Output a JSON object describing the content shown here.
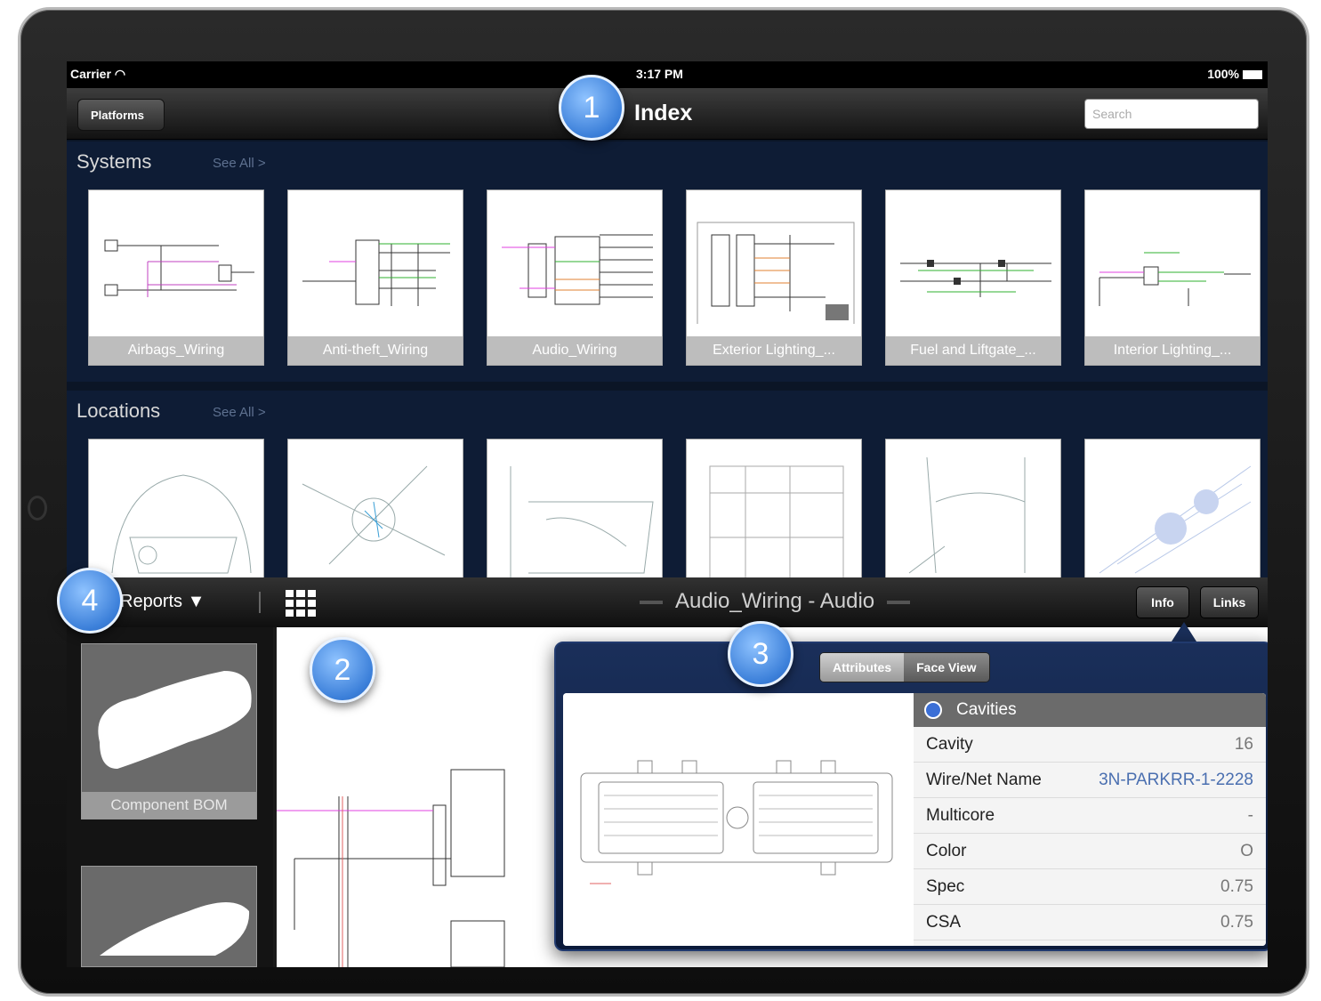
{
  "status_bar": {
    "carrier": "Carrier",
    "time": "3:17 PM",
    "battery": "100%"
  },
  "nav": {
    "back_label": "Platforms",
    "title": "Index",
    "search_placeholder": "Search"
  },
  "systems": {
    "title": "Systems",
    "see_all": "See All >",
    "tiles": [
      "Airbags_Wiring",
      "Anti-theft_Wiring",
      "Audio_Wiring",
      "Exterior Lighting_...",
      "Fuel and Liftgate_...",
      "Interior Lighting_..."
    ]
  },
  "locations": {
    "title": "Locations",
    "see_all": "See All >"
  },
  "toolbar": {
    "reports_label": "Reports",
    "document_title": "Audio_Wiring - Audio",
    "info_label": "Info",
    "links_label": "Links"
  },
  "left_panel": {
    "bom_label": "Component BOM"
  },
  "popover": {
    "tabs": [
      "Attributes",
      "Face View"
    ],
    "section_title": "Cavities",
    "rows": [
      {
        "key": "Cavity",
        "value": "16"
      },
      {
        "key": "Wire/Net Name",
        "value": "3N-PARKRR-1-2228"
      },
      {
        "key": "Multicore",
        "value": "-"
      },
      {
        "key": "Color",
        "value": "O"
      },
      {
        "key": "Spec",
        "value": "0.75"
      },
      {
        "key": "CSA",
        "value": "0.75"
      }
    ]
  },
  "callouts": [
    "1",
    "2",
    "3",
    "4"
  ],
  "colors": {
    "section_bg": "#0e1c35",
    "badge": "#3b7fd9",
    "link": "#4a6fb0"
  }
}
